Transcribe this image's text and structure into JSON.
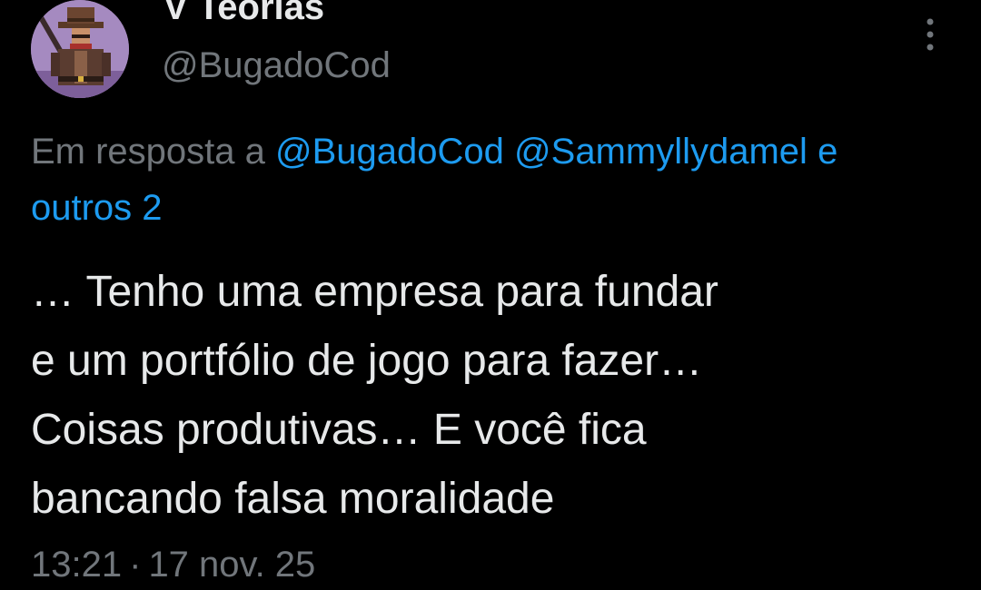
{
  "author": {
    "display_name": "V Teorias",
    "handle": "@BugadoCod",
    "avatar": "pixel-art-cowboy-avatar"
  },
  "actions": {
    "more_icon": "more-vertical-icon"
  },
  "reply_context": {
    "prefix": "Em resposta a ",
    "mention_1": "@BugadoCod",
    "mention_2": "@Sammyllydamel",
    "trailing": "e",
    "others": "outros 2"
  },
  "tweet": {
    "lines": [
      "… Tenho uma empresa para fundar",
      "e um portfólio de jogo para fazer…",
      "Coisas produtivas… E você fica",
      "bancando falsa moralidade"
    ]
  },
  "meta": {
    "time": "13:21",
    "separator": "·",
    "date": "17 nov. 25"
  },
  "colors": {
    "background": "#000000",
    "text": "#e7e9ea",
    "secondary": "#71767b",
    "link": "#1d9bf0"
  }
}
